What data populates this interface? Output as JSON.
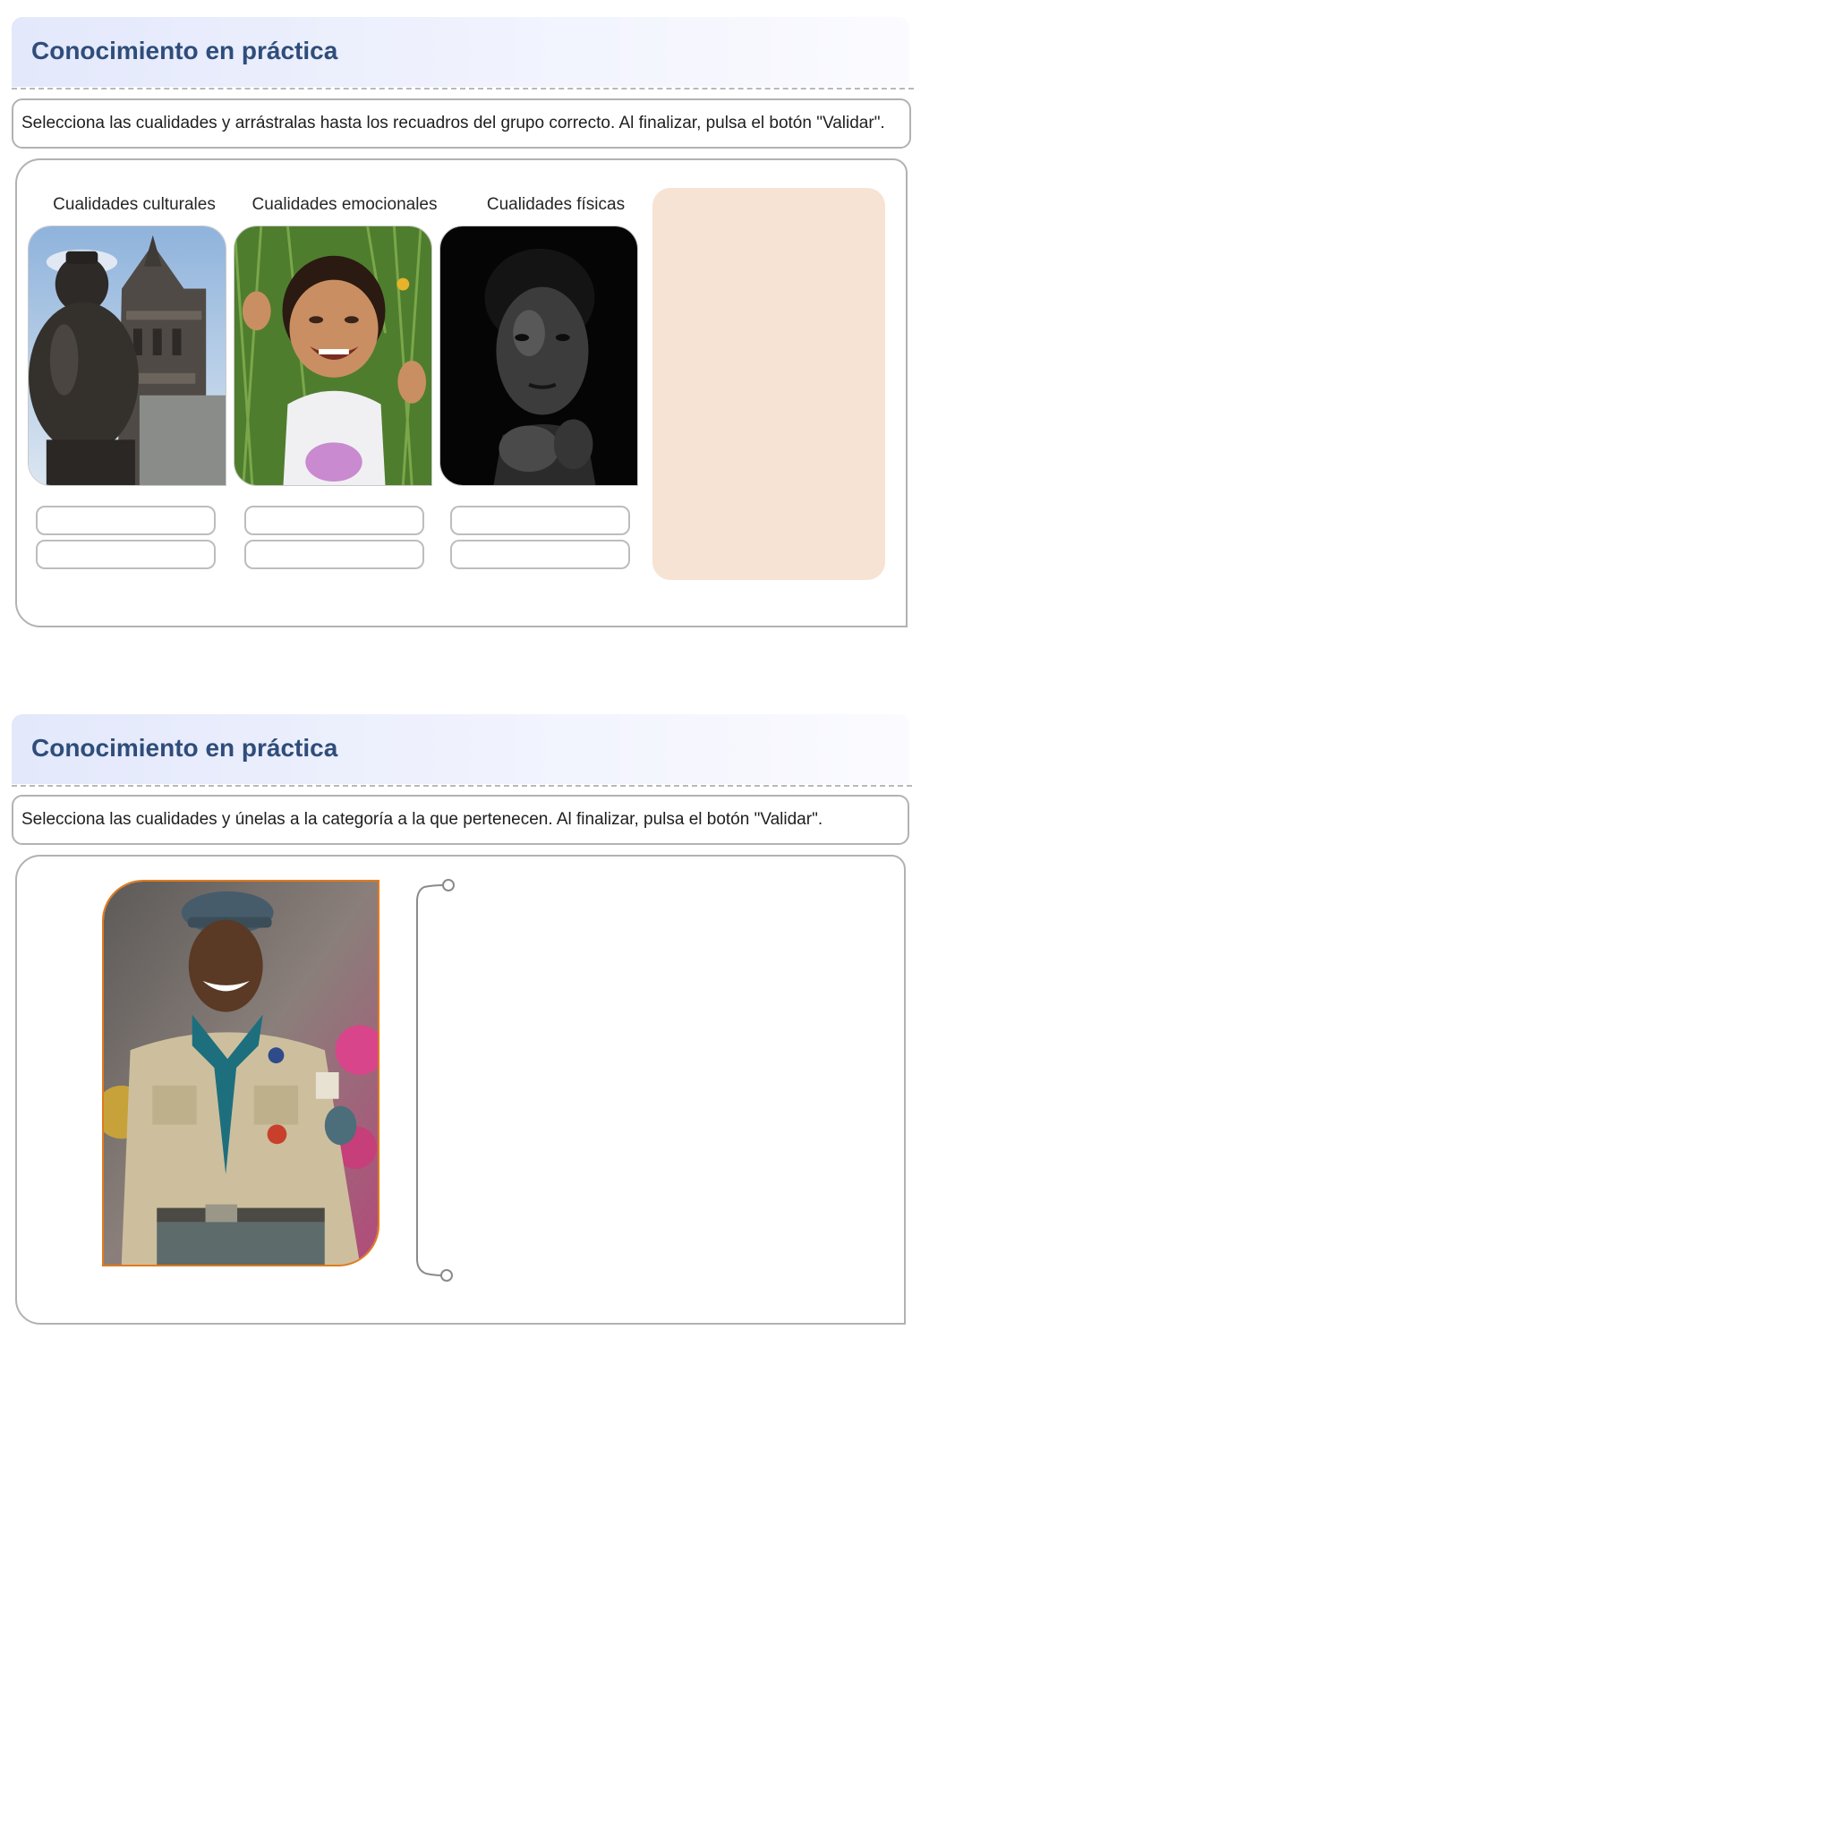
{
  "activity1": {
    "header_title": "Conocimiento en práctica",
    "instruction": "Selecciona las cualidades y arrástralas hasta los recuadros del grupo correcto. Al finalizar, pulsa el botón \"Validar\".",
    "columns": [
      {
        "label": "Cualidades culturales",
        "image": "statue-and-cathedral-photo"
      },
      {
        "label": "Cualidades emocionales",
        "image": "smiling-girl-photo"
      },
      {
        "label": "Cualidades físicas",
        "image": "woman-portrait-photo"
      }
    ],
    "tray_color": "#f6e3d4"
  },
  "activity2": {
    "header_title": "Conocimiento en práctica",
    "instruction": "Selecciona las cualidades y únelas a la categoría a la que pertenecen. Al finalizar, pulsa el botón \"Validar\".",
    "image": "smiling-scout-photo",
    "image_border_color": "#e27a1c"
  },
  "colors": {
    "title": "#2f4d7a",
    "header_gradient_start": "#e3e8fb",
    "border": "#b2b2b2"
  }
}
